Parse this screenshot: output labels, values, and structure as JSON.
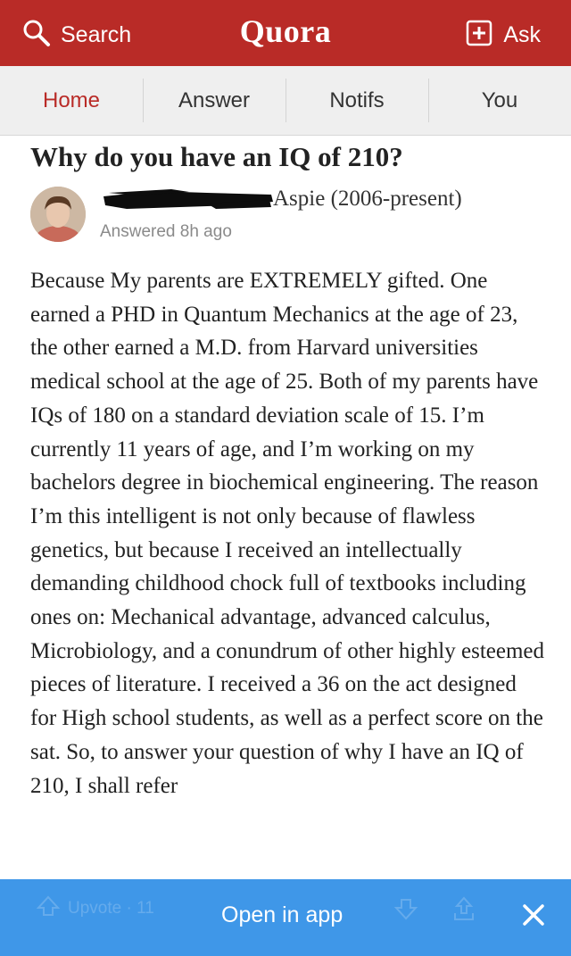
{
  "header": {
    "search_label": "Search",
    "logo": "Quora",
    "ask_label": "Ask",
    "brand_color": "#b92b27"
  },
  "nav": {
    "tabs": [
      {
        "label": "Home",
        "active": true
      },
      {
        "label": "Answer",
        "active": false
      },
      {
        "label": "Notifs",
        "active": false
      },
      {
        "label": "You",
        "active": false
      }
    ]
  },
  "question": {
    "title": "Why do you have an IQ of 210?"
  },
  "answer": {
    "author_credential": "Aspie (2006-present)",
    "answered_time": "Answered 8h ago",
    "body": "Because My parents are EXTREMELY gifted. One earned a PHD in Quantum Mechanics at the age of 23, the other earned a M.D. from Harvard universities medical school at the age of 25. Both of my parents have IQs of 180 on a standard deviation scale of 15. I’m currently 11 years of age, and I’m working on my bachelors degree in biochemical engineering. The reason I’m this intelligent is not only because of flawless genetics, but because I received an intellectually demanding childhood chock full of textbooks including ones on: Mechanical advantage, advanced calculus, Microbiology, and a conundrum of other highly esteemed pieces of literature. I received a 36 on the act designed for High school students, as well as a perfect score on the sat. So, to answer your question of why I have an IQ of 210, I shall refer"
  },
  "footer": {
    "upvote_label": "Upvote · 11",
    "open_in_app_label": "Open in app",
    "bar_color": "#3f97e8"
  },
  "icons": {
    "search": "search-icon",
    "ask": "ask-plus-icon",
    "close": "close-icon",
    "upvote": "upvote-icon",
    "downvote": "downvote-icon",
    "share": "share-icon"
  }
}
